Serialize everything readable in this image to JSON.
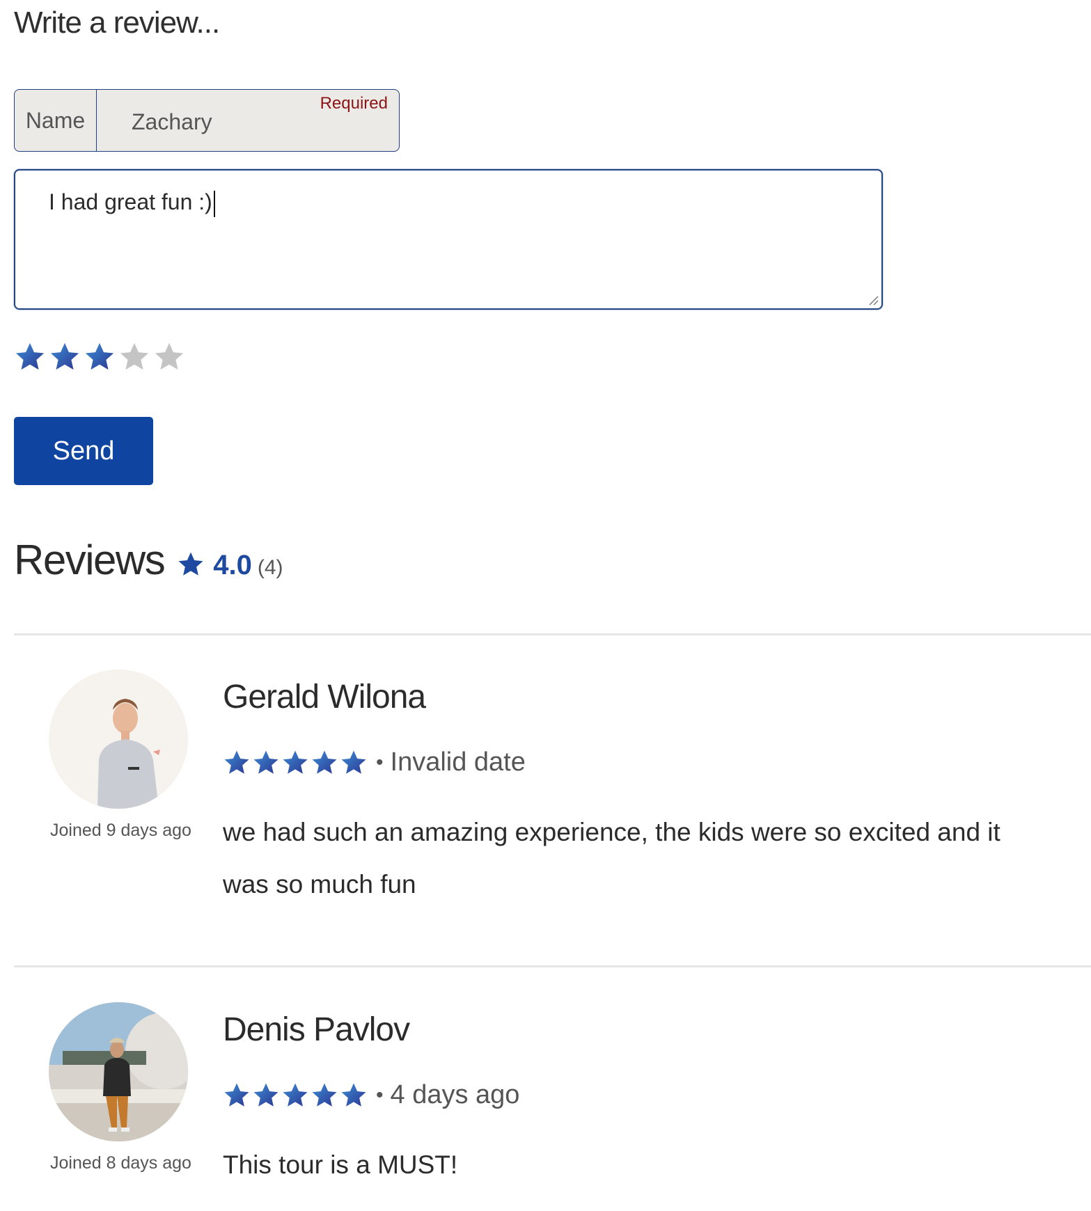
{
  "form": {
    "title": "Write a review...",
    "name_label": "Name",
    "name_value": "Zachary",
    "required_label": "Required",
    "review_text": "I had great fun :)",
    "rating": 3,
    "max_rating": 5,
    "send_label": "Send"
  },
  "reviews_header": {
    "title": "Reviews",
    "score": "4.0",
    "count": "(4)"
  },
  "colors": {
    "star_gradient_start": "#3d8ed6",
    "star_gradient_end": "#2b3590",
    "star_empty": "#c4c4c4",
    "button": "#0f44a0",
    "score": "#1d4aa0",
    "required": "#8b1414"
  },
  "reviews": [
    {
      "name": "Gerald Wilona",
      "rating": 5,
      "date": "Invalid date",
      "text": "we had such an amazing experience, the kids were so excited and it was so much fun",
      "joined": "Joined 9 days ago",
      "avatar_icon": "avatar-photo"
    },
    {
      "name": "Denis Pavlov",
      "rating": 5,
      "date": "4 days ago",
      "text": "This tour is a MUST!",
      "joined": "Joined 8 days ago",
      "avatar_icon": "avatar-photo"
    }
  ]
}
